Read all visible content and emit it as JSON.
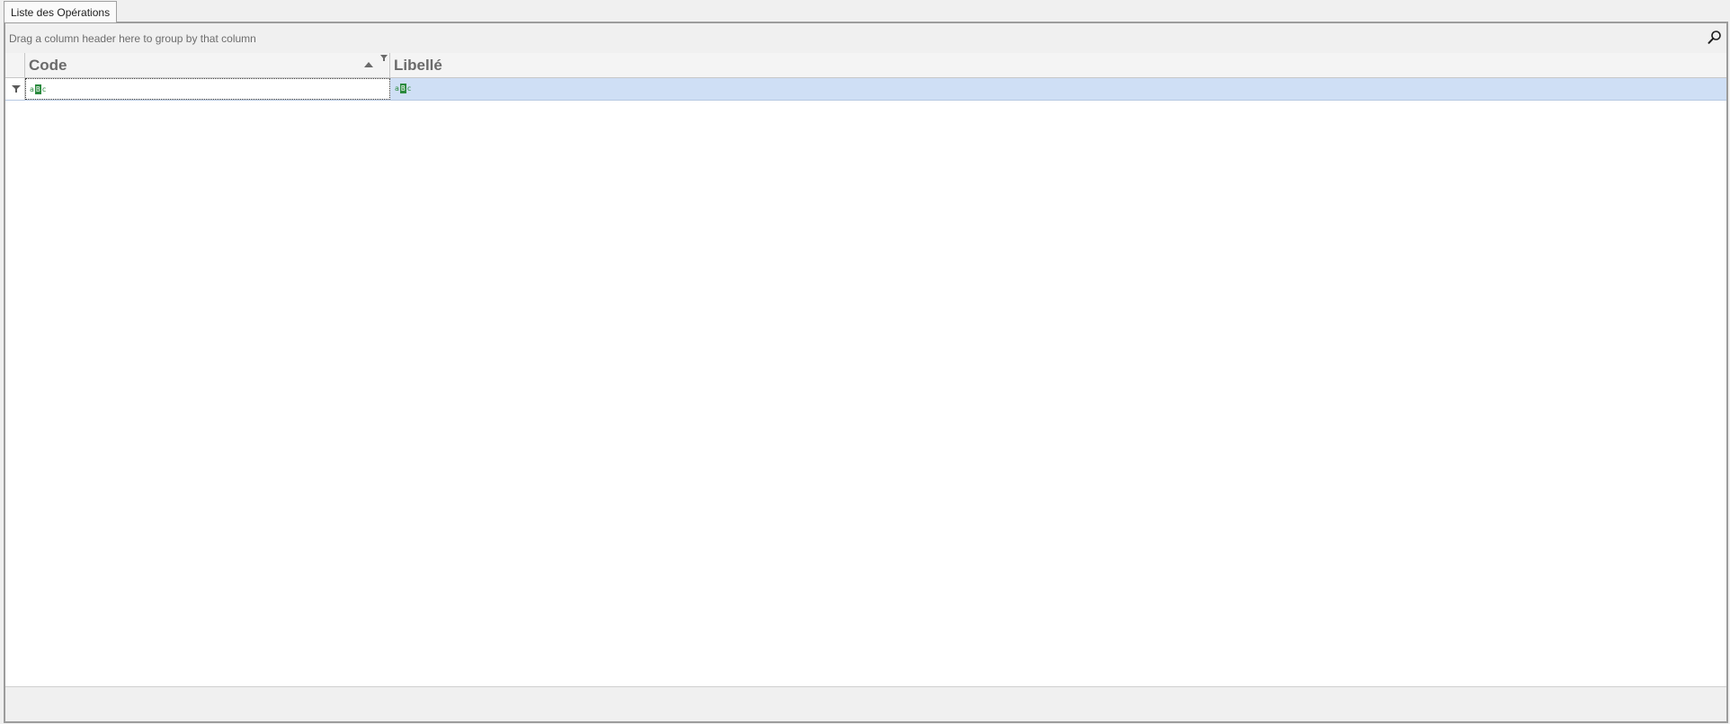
{
  "tabs": [
    {
      "label": "Liste des Opérations"
    }
  ],
  "grid": {
    "group_panel_text": "Drag a column header here to group by that column",
    "columns": [
      {
        "label": "Code",
        "sort": "ascending"
      },
      {
        "label": "Libellé"
      }
    ],
    "filter_row": {
      "code_value": "",
      "libelle_value": ""
    },
    "rows": []
  },
  "icons": {
    "search": "search-icon",
    "sort": "sort-ascending-icon",
    "filter": "funnel-icon",
    "filter_dropdown": "filter-dropdown-icon",
    "text_filter": "abc-icon"
  },
  "colors": {
    "filter_row_bg": "#cfdff5",
    "abc_icon": "#2b8a3e",
    "header_text": "#6a6a6a"
  }
}
